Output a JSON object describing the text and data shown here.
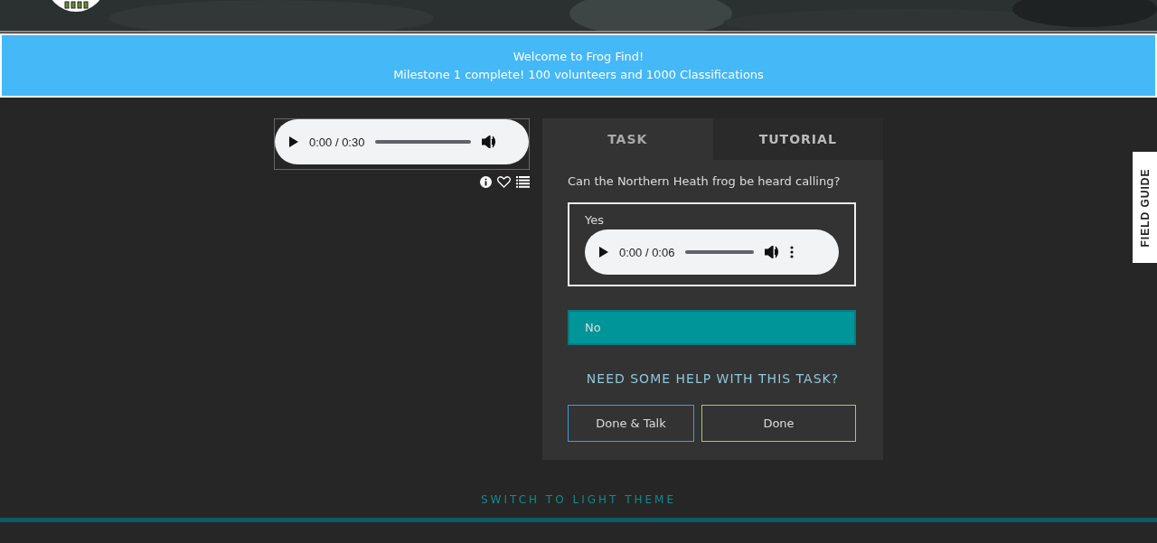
{
  "banner": {
    "lines": [
      "Welcome to Frog Find!",
      "Milestone 1 complete! 100 volunteers and 1000 Classifications"
    ]
  },
  "subject": {
    "audio": {
      "time": "0:00 / 0:30"
    }
  },
  "tabs": [
    {
      "label": "TASK",
      "selected": true
    },
    {
      "label": "TUTORIAL",
      "selected": false
    }
  ],
  "task": {
    "question": "Can the Northern Heath frog be heard calling?",
    "answers": [
      {
        "kind": "audio",
        "label": "Yes",
        "selected": false,
        "audio": {
          "time": "0:00 / 0:06"
        }
      },
      {
        "kind": "plain",
        "label": "No",
        "selected": true
      }
    ],
    "help": "NEED SOME HELP WITH THIS TASK?",
    "buttons": [
      {
        "kind": "talk",
        "label": "Done & Talk"
      },
      {
        "kind": "done",
        "label": "Done"
      }
    ]
  },
  "field_guide": "FIELD GUIDE",
  "theme_switch": "SWITCH TO LIGHT THEME"
}
